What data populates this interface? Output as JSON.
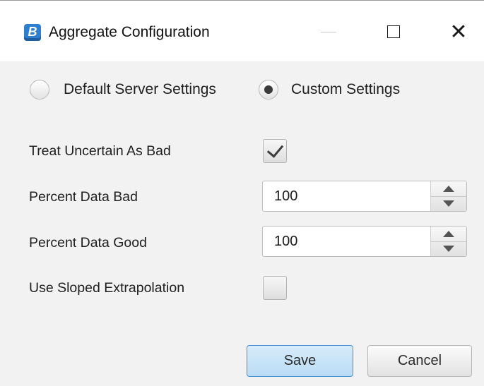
{
  "window": {
    "title": "Aggregate Configuration",
    "app_icon_letter": "B",
    "controls": {
      "minimize": "—",
      "maximize": "☐",
      "close": "✕"
    }
  },
  "settings_mode": {
    "options": [
      {
        "label": "Default Server Settings",
        "selected": false
      },
      {
        "label": "Custom Settings",
        "selected": true
      }
    ]
  },
  "fields": {
    "treat_uncertain_as_bad": {
      "label": "Treat Uncertain As Bad",
      "checked": true
    },
    "percent_data_bad": {
      "label": "Percent Data Bad",
      "value": "100"
    },
    "percent_data_good": {
      "label": "Percent Data Good",
      "value": "100"
    },
    "use_sloped_extrapolation": {
      "label": "Use Sloped Extrapolation",
      "checked": false
    }
  },
  "buttons": {
    "save_label": "Save",
    "cancel_label": "Cancel"
  },
  "colors": {
    "accent": "#3f8fd6",
    "save_fill": "#c8e3f7",
    "app_icon": "#2f7fd0"
  }
}
